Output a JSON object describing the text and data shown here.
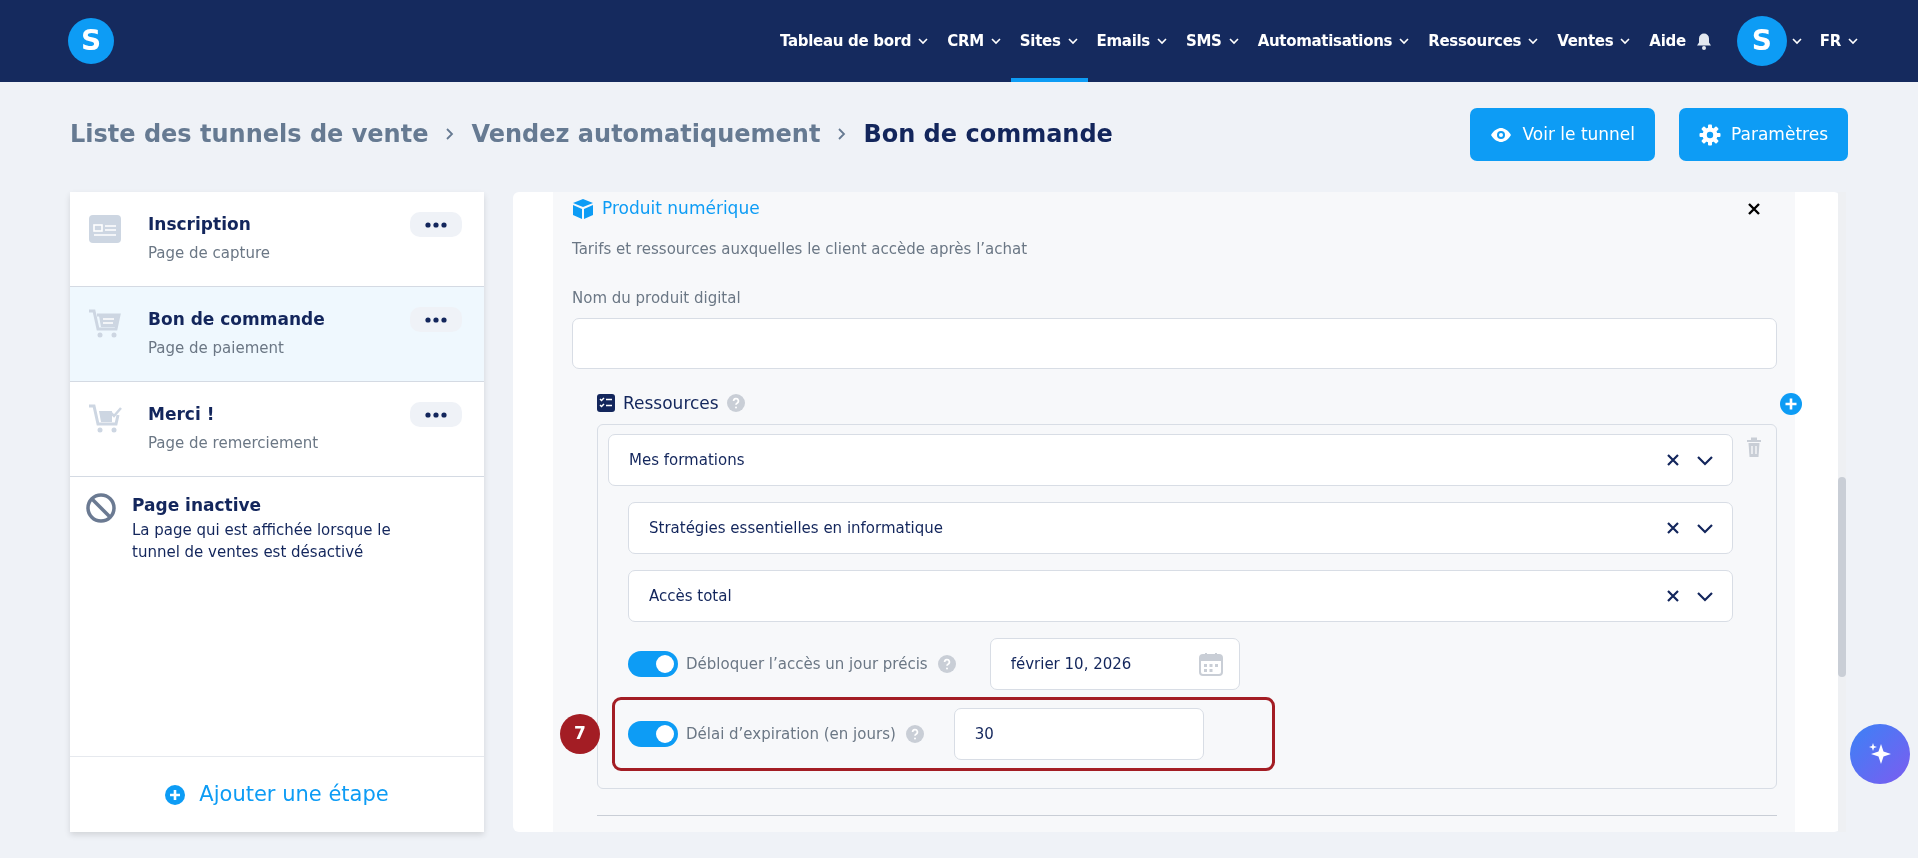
{
  "navbar": {
    "logo": "S",
    "menu": [
      {
        "label": "Tableau de bord",
        "dropdown": true,
        "selected": false
      },
      {
        "label": "CRM",
        "dropdown": true,
        "selected": false
      },
      {
        "label": "Sites",
        "dropdown": true,
        "selected": true
      },
      {
        "label": "Emails",
        "dropdown": true,
        "selected": false
      },
      {
        "label": "SMS",
        "dropdown": true,
        "selected": false
      },
      {
        "label": "Automatisations",
        "dropdown": true,
        "selected": false
      },
      {
        "label": "Ressources",
        "dropdown": true,
        "selected": false
      },
      {
        "label": "Ventes",
        "dropdown": true,
        "selected": false
      },
      {
        "label": "Aide",
        "dropdown": false,
        "selected": false
      }
    ],
    "avatar": "S",
    "language": "FR"
  },
  "breadcrumb": [
    "Liste des tunnels de vente",
    "Vendez automatiquement",
    "Bon de commande"
  ],
  "actions": [
    {
      "kind": "view",
      "label": "Voir le tunnel"
    },
    {
      "kind": "settings",
      "label": "Paramètres"
    }
  ],
  "sidebar": {
    "steps": [
      {
        "kind": "form",
        "title": "Inscription",
        "subtitle": "Page de capture",
        "selected": false
      },
      {
        "kind": "cart",
        "title": "Bon de commande",
        "subtitle": "Page de paiement",
        "selected": true
      },
      {
        "kind": "cart-check",
        "title": "Merci !",
        "subtitle": "Page de remerciement",
        "selected": false
      }
    ],
    "inactive": {
      "title": "Page inactive",
      "description": "La page qui est affichée lorsque le tunnel de ventes est désactivé"
    },
    "add_step": "Ajouter une étape"
  },
  "product": {
    "title": "Produit numérique",
    "description": "Tarifs et ressources auxquelles le client accède après l’achat",
    "name_label": "Nom du produit digital",
    "resources": {
      "title": "Ressources",
      "selects": [
        {
          "value": "Mes formations",
          "nested": false
        },
        {
          "value": "Stratégies essentielles en informatique",
          "nested": true
        },
        {
          "value": "Accès total",
          "nested": true
        }
      ],
      "options": [
        {
          "kind": "date",
          "label": "Débloquer l’accès un jour précis",
          "on": true,
          "value": "février 10, 2026",
          "highlighted": false
        },
        {
          "kind": "number",
          "label": "Délai d’expiration (en jours)",
          "on": true,
          "value": "30",
          "highlighted": true,
          "badge": "7"
        }
      ]
    }
  }
}
